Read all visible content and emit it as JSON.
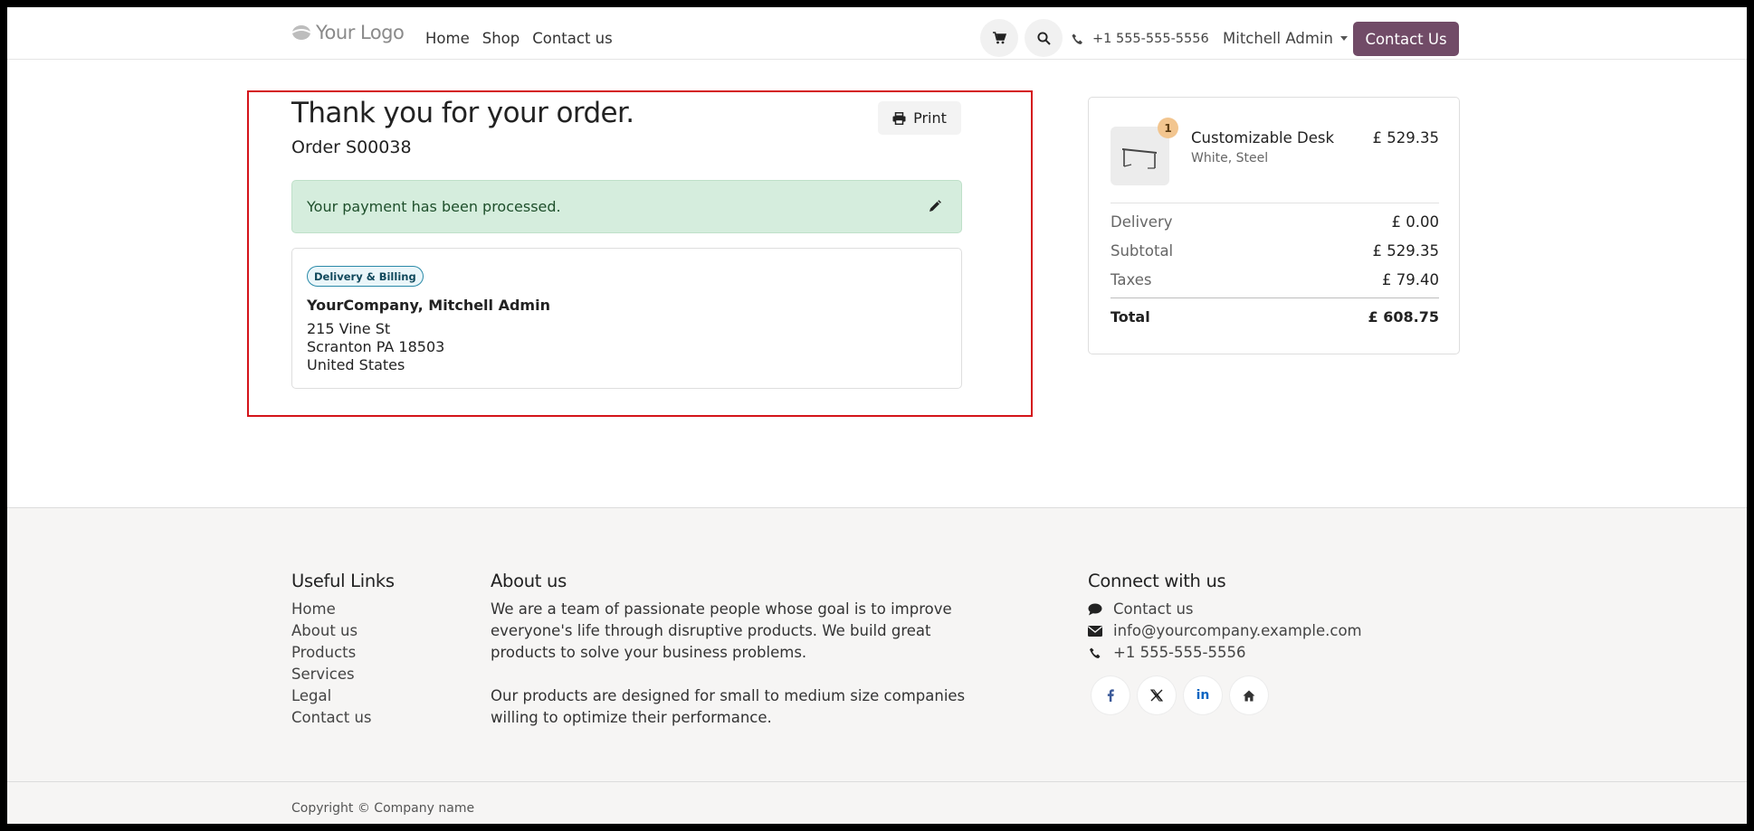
{
  "header": {
    "logo_text": "Your Logo",
    "nav": [
      "Home",
      "Shop",
      "Contact us"
    ],
    "phone": "+1 555-555-5556",
    "user": "Mitchell Admin",
    "contact_button": "Contact Us",
    "icons": {
      "cart": "cart-icon",
      "search": "search-icon",
      "phone": "phone-icon"
    }
  },
  "confirmation": {
    "title": "Thank you for your order.",
    "order_number": "Order S00038",
    "print_label": "Print",
    "payment_status": "Your payment has been processed.",
    "address_badge": "Delivery & Billing",
    "address_name": "YourCompany, Mitchell Admin",
    "address_lines": [
      "215 Vine St",
      "Scranton PA 18503",
      "United States"
    ]
  },
  "summary": {
    "product": {
      "name": "Customizable Desk",
      "variant": "White, Steel",
      "price": "£ 529.35",
      "quantity": "1"
    },
    "delivery": {
      "label": "Delivery",
      "value": "£ 0.00"
    },
    "subtotal": {
      "label": "Subtotal",
      "value": "£ 529.35"
    },
    "taxes": {
      "label": "Taxes",
      "value": "£ 79.40"
    },
    "total": {
      "label": "Total",
      "value": "£ 608.75"
    }
  },
  "footer": {
    "useful_links_title": "Useful Links",
    "useful_links": [
      "Home",
      "About us",
      "Products",
      "Services",
      "Legal",
      "Contact us"
    ],
    "about_title": "About us",
    "about_p1": "We are a team of passionate people whose goal is to improve everyone's life through disruptive products. We build great products to solve your business problems.",
    "about_p2": "Our products are designed for small to medium size companies willing to optimize their performance.",
    "connect_title": "Connect with us",
    "connect_contact": "Contact us",
    "connect_email": "info@yourcompany.example.com",
    "connect_phone": "+1 555-555-5556",
    "social_icons": [
      "facebook-icon",
      "x-icon",
      "linkedin-icon",
      "home-icon"
    ],
    "copyright": "Copyright © Company name"
  },
  "colors": {
    "brand": "#714b67",
    "alert_bg": "#d5eddd",
    "highlight": "#d4141a"
  }
}
